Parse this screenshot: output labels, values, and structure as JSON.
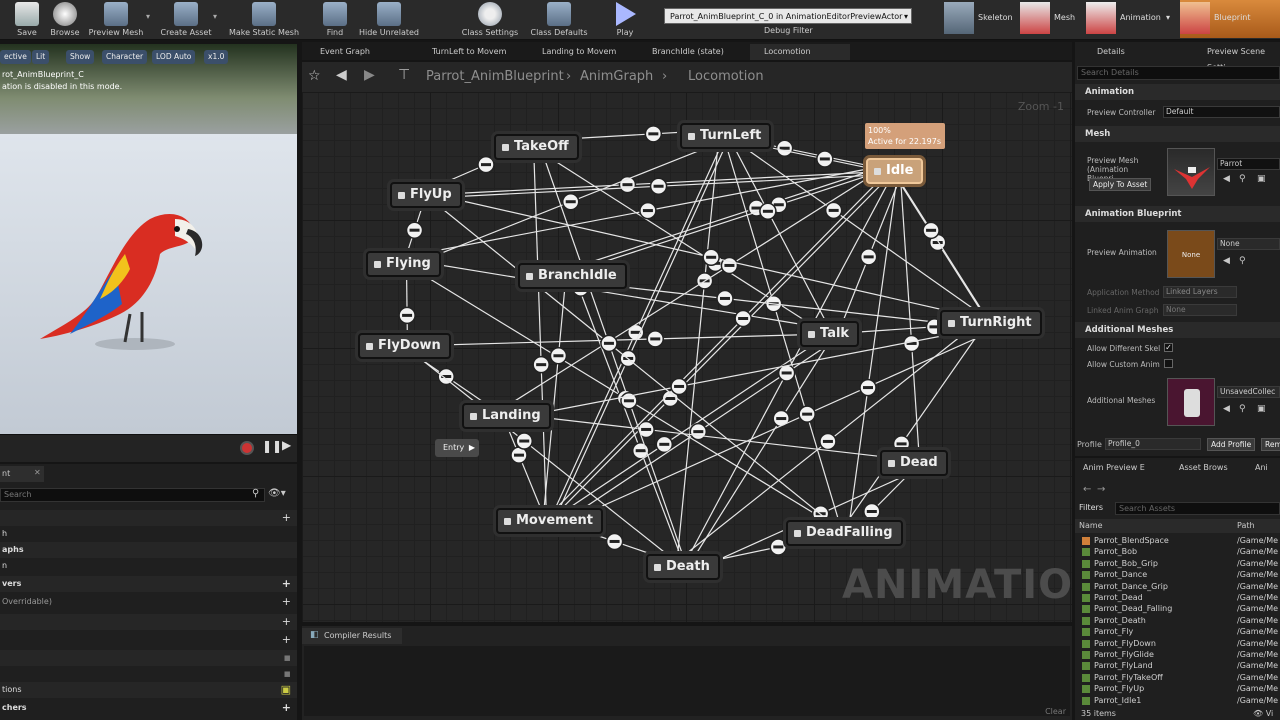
{
  "toolbar": {
    "buttons": [
      {
        "label": "Save",
        "icon": "save-icon"
      },
      {
        "label": "Browse",
        "icon": "browse-icon"
      },
      {
        "label": "Preview Mesh",
        "icon": "preview-mesh-icon"
      },
      {
        "label": "Create Asset",
        "icon": "create-asset-icon"
      },
      {
        "label": "Make Static Mesh",
        "icon": "static-mesh-icon"
      },
      {
        "label": "Find",
        "icon": "find-icon"
      },
      {
        "label": "Hide Unrelated",
        "icon": "hide-unrelated-icon"
      },
      {
        "label": "Class Settings",
        "icon": "gear-icon"
      },
      {
        "label": "Class Defaults",
        "icon": "class-defaults-icon"
      },
      {
        "label": "Play",
        "icon": "play-icon"
      }
    ],
    "debug_filter_value": "Parrot_AnimBlueprint_C_0 in AnimationEditorPreviewActor",
    "debug_filter_label": "Debug Filter",
    "modes": {
      "skeleton": "Skeleton",
      "mesh": "Mesh",
      "animation": "Animation",
      "blueprint": "Blueprint"
    }
  },
  "viewport": {
    "pills": [
      "ective",
      "Lit",
      "Show",
      "Character",
      "LOD Auto",
      "x1.0"
    ],
    "line1": "rot_AnimBlueprint_C",
    "line2": "ation is disabled in this mode."
  },
  "left_panel": {
    "tab": "nt",
    "search_placeholder": "Search",
    "rows": [
      "h",
      "aphs",
      "n",
      "vers",
      "Overridable)",
      "",
      "",
      "",
      "",
      "tions",
      "chers"
    ]
  },
  "graph": {
    "tabs": [
      "Event Graph",
      "TurnLeft to Movem",
      "Landing to Movem",
      "BranchIdle (state)",
      "Locomotion"
    ],
    "breadcrumb": {
      "root": "Parrot_AnimBlueprint",
      "mid": "AnimGraph",
      "leaf": "Locomotion"
    },
    "zoom": "Zoom -1",
    "nodes": {
      "takeoff": "TakeOff",
      "turnleft": "TurnLeft",
      "idle": "Idle",
      "flyup": "FlyUp",
      "flying": "Flying",
      "branchidle": "BranchIdle",
      "turnright": "TurnRight",
      "talk": "Talk",
      "flydown": "FlyDown",
      "landing": "Landing",
      "dead": "Dead",
      "movement": "Movement",
      "deadfalling": "DeadFalling",
      "death": "Death"
    },
    "idle_tooltip": {
      "line1": "100%",
      "line2": "Active for 22.197s"
    },
    "entry": "Entry",
    "watermark": "ANIMATION"
  },
  "compiler": {
    "tab": "Compiler Results",
    "clear": "Clear"
  },
  "details": {
    "tab1": "Details",
    "tab2": "Preview Scene Setti",
    "search_placeholder": "Search Details",
    "sec_animation": "Animation",
    "preview_controller_label": "Preview Controller",
    "preview_controller_value": "Default",
    "sec_mesh": "Mesh",
    "preview_mesh_label": "Preview Mesh (Animation Bluepri",
    "preview_mesh_value": "Parrot",
    "apply_to_asset": "Apply To Asset",
    "sec_anim_bp": "Animation Blueprint",
    "preview_animation_label": "Preview Animation",
    "preview_animation_value": "None",
    "thumb_none": "None",
    "app_method_label": "Application Method",
    "app_method_value": "Linked Layers",
    "linked_graph_label": "Linked Anim Graph",
    "linked_graph_value": "None",
    "sec_additional": "Additional Meshes",
    "allow_diff_label": "Allow Different Skel",
    "allow_custom_label": "Allow Custom Anim",
    "additional_meshes_label": "Additional Meshes",
    "additional_meshes_value": "UnsavedCollec",
    "profile_label": "Profile",
    "profile_value": "Profile_0",
    "add_profile": "Add Profile",
    "remove_profile": "Rem"
  },
  "assets": {
    "tab1": "Anim Preview E",
    "tab2": "Asset Brows",
    "tab3": "Ani",
    "filters": "Filters",
    "search_placeholder": "Search Assets",
    "col_name": "Name",
    "col_path": "Path",
    "rows": [
      {
        "name": "Parrot_BlendSpace",
        "path": "/Game/Me"
      },
      {
        "name": "Parrot_Bob",
        "path": "/Game/Me"
      },
      {
        "name": "Parrot_Bob_Grip",
        "path": "/Game/Me"
      },
      {
        "name": "Parrot_Dance",
        "path": "/Game/Me"
      },
      {
        "name": "Parrot_Dance_Grip",
        "path": "/Game/Me"
      },
      {
        "name": "Parrot_Dead",
        "path": "/Game/Me"
      },
      {
        "name": "Parrot_Dead_Falling",
        "path": "/Game/Me"
      },
      {
        "name": "Parrot_Death",
        "path": "/Game/Me"
      },
      {
        "name": "Parrot_Fly",
        "path": "/Game/Me"
      },
      {
        "name": "Parrot_FlyDown",
        "path": "/Game/Me"
      },
      {
        "name": "Parrot_FlyGlide",
        "path": "/Game/Me"
      },
      {
        "name": "Parrot_FlyLand",
        "path": "/Game/Me"
      },
      {
        "name": "Parrot_FlyTakeOff",
        "path": "/Game/Me"
      },
      {
        "name": "Parrot_FlyUp",
        "path": "/Game/Me"
      },
      {
        "name": "Parrot_Idle1",
        "path": "/Game/Me"
      }
    ],
    "count": "35 items",
    "view": "Vi"
  },
  "colors": {
    "accent": "#d98a3c",
    "idle_active": "#c9a27a",
    "graph_bg": "#262626"
  }
}
